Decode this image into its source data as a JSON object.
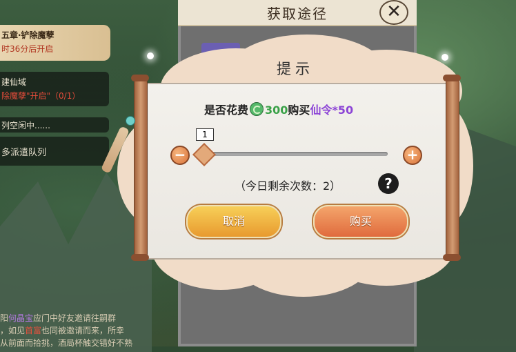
{
  "background": {
    "quests": [
      {
        "title": "五章·铲除魔孽",
        "subtitle": "时36分后开启"
      },
      {
        "title": "建仙域",
        "subtitle": "除魔孽\"开启\"（0/1）"
      },
      {
        "title": "列空闲中......"
      },
      {
        "title": "多派遣队列"
      }
    ],
    "bottom_text": {
      "line1_a": "阳",
      "line1_b": "何晶宝",
      "line1_c": "应门中好友邀请往嗣群",
      "line2_a": "，如见",
      "line2_b": "首富",
      "line2_c": "也同被邀请而来，所幸",
      "line3": "从前面而拾挑，酒局杯触交错好不熟"
    }
  },
  "back_panel": {
    "title": "获取途径",
    "close_icon": "close-icon"
  },
  "dialog": {
    "title": "提示",
    "cost": {
      "prefix": "是否花费",
      "currency_icon": "jade-coin-icon",
      "amount": "300",
      "middle": "购买",
      "item": "仙令*50"
    },
    "quantity": "1",
    "slider": {
      "value": 1,
      "min": 1
    },
    "remaining_text": "（今日剩余次数：2）",
    "help_label": "?",
    "minus_label": "−",
    "plus_label": "+",
    "cancel_label": "取消",
    "buy_label": "购买"
  },
  "colors": {
    "green_amount": "#3aa148",
    "purple_item": "#8c44d6",
    "cancel_button": "#f2b441",
    "buy_button": "#ea8450"
  }
}
